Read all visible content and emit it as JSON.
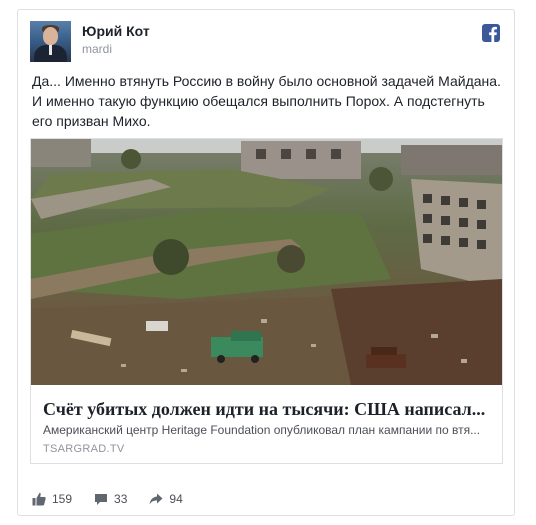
{
  "post": {
    "author_name": "Юрий Кот",
    "author_handle": "mardi",
    "text": "Да... Именно втянуть Россию в войну было основной задачей Майдана. И именно такую функцию обещался выполнить Порох. А подстегнуть его призван Михо."
  },
  "link_preview": {
    "title": "Счёт убитых должен идти на тысячи: США написал...",
    "description": "Американский центр Heritage Foundation опубликовал план кампании по втя...",
    "domain": "TSARGRAD.TV"
  },
  "stats": {
    "likes": "159",
    "comments": "33",
    "shares": "94"
  },
  "icons": {
    "network": "facebook-icon",
    "likes": "thumbs-up-icon",
    "comments": "comment-icon",
    "shares": "share-icon"
  },
  "colors": {
    "facebook_blue": "#3b5998",
    "text": "#1d2129",
    "muted": "#90949c",
    "border": "#dddfe2"
  }
}
